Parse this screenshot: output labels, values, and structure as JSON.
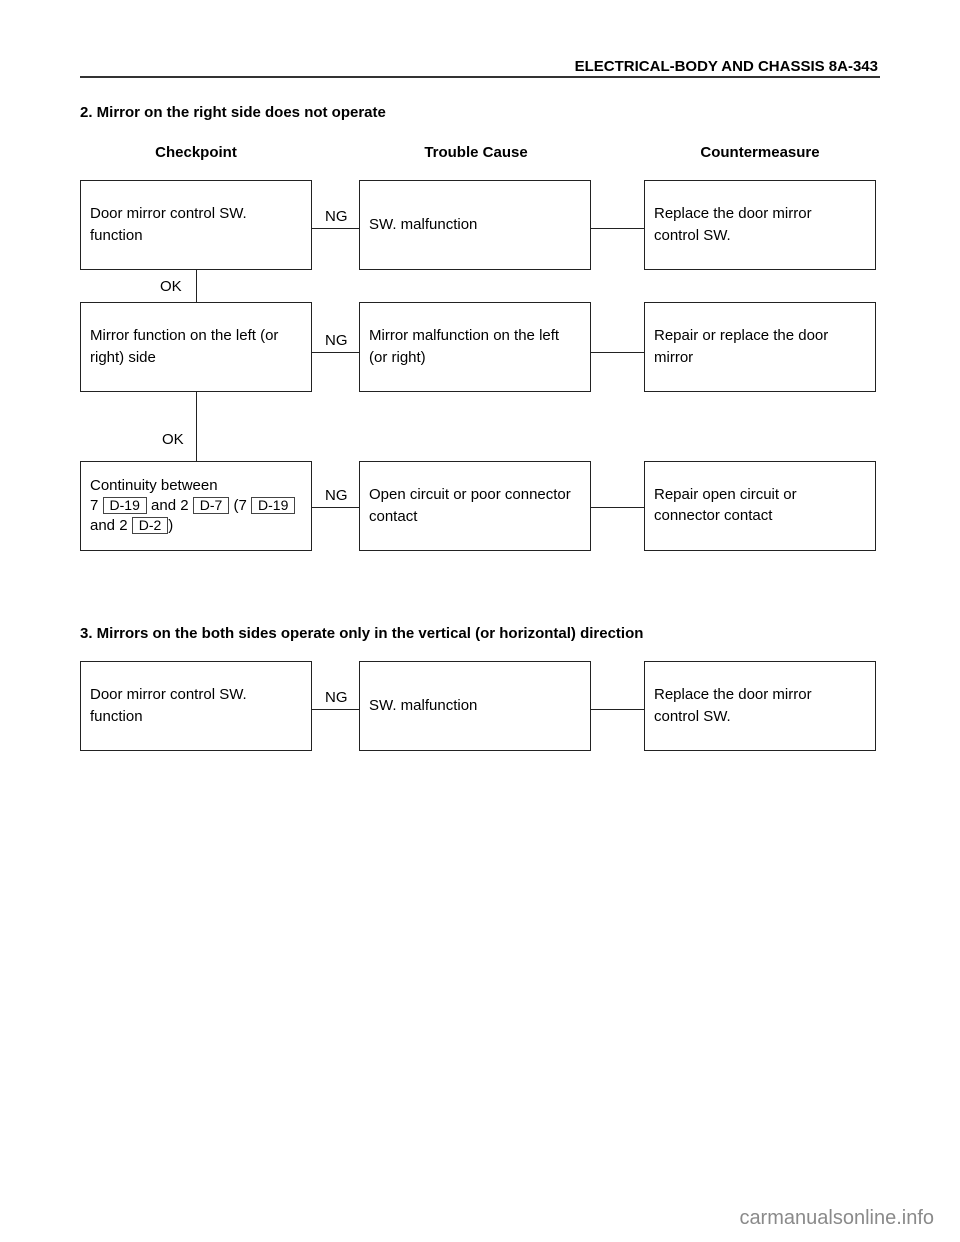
{
  "header": {
    "title": "ELECTRICAL-BODY AND CHASSIS  8A-343"
  },
  "section2": {
    "title": "2.  Mirror on the right side does not operate",
    "columns": [
      "Checkpoint",
      "Trouble Cause",
      "Countermeasure"
    ],
    "rows": [
      {
        "checkpoint": [
          "Door mirror control SW.",
          "function"
        ],
        "link": "NG",
        "cause": [
          "SW. malfunction"
        ],
        "countermeasure": [
          "Replace the door mirror",
          "control SW."
        ],
        "next": "OK"
      },
      {
        "checkpoint": [
          "Mirror function on the left (or",
          "right) side"
        ],
        "link": "NG",
        "cause": [
          "Mirror malfunction on the left",
          "(or right)"
        ],
        "countermeasure": [
          "Repair or replace the door",
          "mirror"
        ],
        "next": "OK"
      },
      {
        "checkpoint_prefix": "Continuity between",
        "link": "NG",
        "cause": [
          "Open circuit or poor connector",
          "contact"
        ],
        "countermeasure": [
          "Repair open circuit or",
          "connector contact"
        ]
      }
    ],
    "continuity": {
      "pin1": "7",
      "ref1": "D-19",
      "and1": "and 2",
      "ref2": "D-7",
      "paren_open": "(7",
      "ref3": "D-19",
      "and2": "and 2",
      "ref4": "D-2",
      "paren_close": ")"
    }
  },
  "section3": {
    "title": "3.  Mirrors on the both sides operate only in the vertical (or horizontal) direction",
    "rows": [
      {
        "checkpoint": [
          "Door mirror control SW.",
          "function"
        ],
        "link": "NG",
        "cause": [
          "SW. malfunction"
        ],
        "countermeasure": [
          "Replace the door mirror",
          "control SW."
        ]
      }
    ]
  },
  "watermark": "carmanualsonline.info"
}
